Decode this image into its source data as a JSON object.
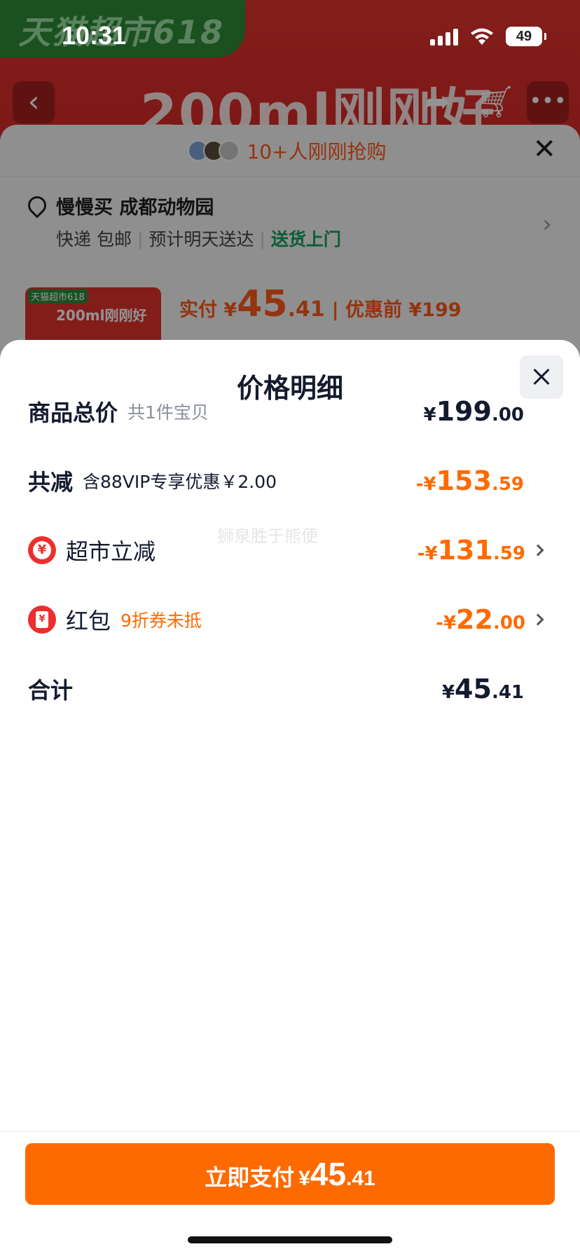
{
  "status_bar": {
    "time": "10:31",
    "battery": "49"
  },
  "background": {
    "hero_tag": "天猫超市618",
    "hero_title": "200ml刚刚好",
    "buyers_text": "10+人刚刚抢购",
    "address": {
      "name": "慢慢买 成都动物园",
      "delivery": "快递 包邮",
      "eta": "预计明天送达",
      "door": "送货上门"
    },
    "product_tag": "天猫超市618",
    "product_title": "200ml刚刚好",
    "price": {
      "label": "实付 ¥",
      "int": "45",
      "dec": ".41",
      "before": "| 优惠前 ¥199"
    }
  },
  "sheet": {
    "title": "价格明细",
    "watermark": "狮泉胜于熊便",
    "rows": [
      {
        "label": "商品总价",
        "note": "共1件宝贝",
        "cur": "¥",
        "int": "199",
        "dec": ".00",
        "color": "#141b2e"
      },
      {
        "label": "共减",
        "note": "含88VIP专享优惠￥2.00",
        "cur": "-¥",
        "int": "153",
        "dec": ".59",
        "color": "#ff6a00"
      },
      {
        "label": "超市立减",
        "note": "",
        "cur": "-¥",
        "int": "131",
        "dec": ".59",
        "color": "#ff6a00",
        "icon": "coin-icon"
      },
      {
        "label": "红包",
        "note": "9折券未抵",
        "cur": "-¥",
        "int": "22",
        "dec": ".00",
        "color": "#ff6a00",
        "icon": "red-packet-icon"
      },
      {
        "label": "合计",
        "note": "",
        "cur": "¥",
        "int": "45",
        "dec": ".41",
        "color": "#141b2e"
      }
    ],
    "pay_button": {
      "label": "立即支付",
      "cur": "¥",
      "int": "45",
      "dec": ".41"
    }
  },
  "colors": {
    "accent": "#ff6a00",
    "text": "#141b2e",
    "muted": "#8a8f99",
    "danger": "#ee2e2e"
  }
}
